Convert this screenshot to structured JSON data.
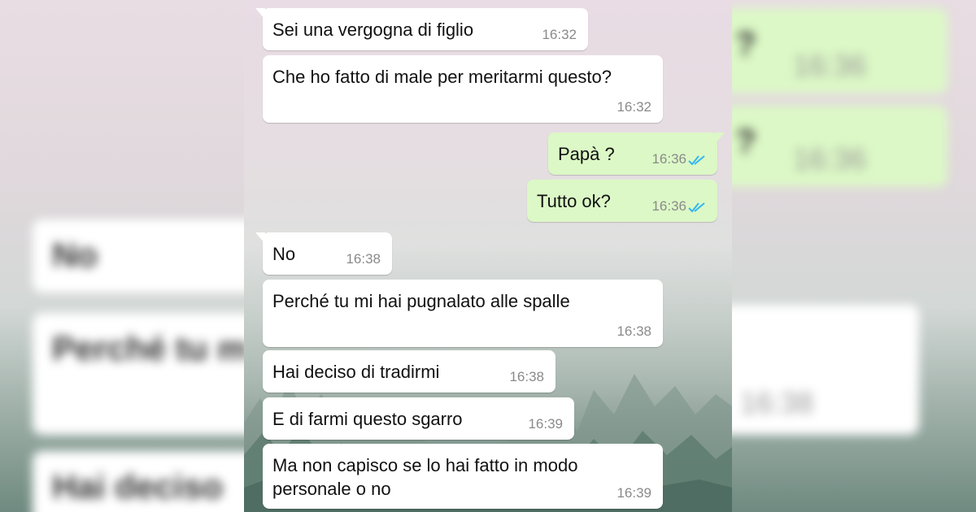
{
  "chat": {
    "messages": [
      {
        "text": "Sei una vergogna di figlio",
        "time": "16:32"
      },
      {
        "text": "Che ho fatto di male per meritarmi questo?",
        "time": "16:32"
      },
      {
        "text": "Papà ?",
        "time": "16:36"
      },
      {
        "text": "Tutto ok?",
        "time": "16:36"
      },
      {
        "text": "No",
        "time": "16:38"
      },
      {
        "text": "Perché tu mi hai pugnalato alle spalle",
        "time": "16:38"
      },
      {
        "text": "Hai deciso di tradirmi",
        "time": "16:38"
      },
      {
        "text": "E di farmi questo sgarro",
        "time": "16:39"
      },
      {
        "text": "Ma non capisco se lo hai fatto in modo personale o no",
        "time": "16:39"
      }
    ]
  },
  "blurred_left": {
    "items": [
      "No",
      "Perché tu m",
      "Hai deciso"
    ]
  },
  "blurred_right": {
    "items": [
      "?",
      "?"
    ],
    "times": [
      "16:36",
      "16:36",
      "16:38"
    ]
  },
  "colors": {
    "incoming_bubble": "#ffffff",
    "outgoing_bubble": "#dcf8c6",
    "read_ticks": "#34b7f1",
    "timestamp": "#8a8a8a"
  },
  "icons": [
    "double-check-read-icon"
  ]
}
